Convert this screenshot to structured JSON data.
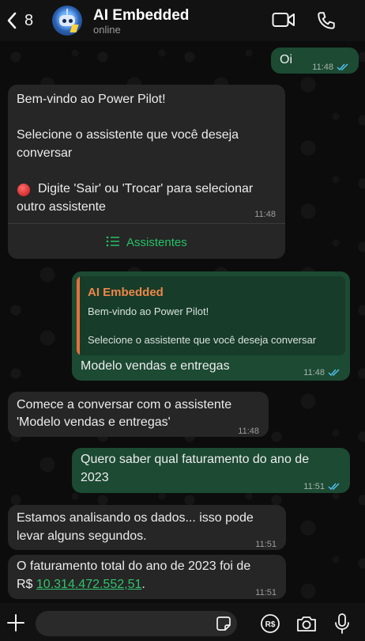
{
  "header": {
    "back_count": "8",
    "title": "AI Embedded",
    "status": "online"
  },
  "colors": {
    "accent": "#25c165",
    "outgoing": "#1c4a33",
    "incoming": "#262626",
    "quote_bar": "#e7713a"
  },
  "messages": [
    {
      "dir": "out",
      "text": "Oi",
      "time": "11:48"
    },
    {
      "dir": "in",
      "line1": "Bem-vindo ao Power Pilot!",
      "line2": "Selecione o assistente que você deseja",
      "line3": "conversar",
      "warn_icon": "red-circle-icon",
      "line4": "Digite 'Sair' ou 'Trocar' para selecionar",
      "line5": "outro assistente",
      "time": "11:48",
      "button_label": "Assistentes"
    },
    {
      "dir": "out",
      "quote_author": "AI Embedded",
      "quote_line1": "Bem-vindo ao Power Pilot!",
      "quote_line2": "Selecione o assistente que você deseja conversar",
      "text": "Modelo vendas e entregas",
      "time": "11:48"
    },
    {
      "dir": "in",
      "line1": "Comece a conversar com o assistente",
      "line2": "'Modelo vendas e entregas'",
      "time": "11:48"
    },
    {
      "dir": "out",
      "line1": "Quero saber qual faturamento do ano de",
      "line2": "2023",
      "time": "11:51"
    },
    {
      "dir": "in",
      "line1": "Estamos analisando os dados... isso pode",
      "line2": "levar alguns segundos.",
      "time": "11:51"
    },
    {
      "dir": "in",
      "line1": "O faturamento total do ano de 2023 foi de",
      "prefix": "R$",
      "amount": "10.314.472.552,51",
      "suffix": ".",
      "time": "11:51"
    }
  ],
  "composer": {
    "placeholder": ""
  }
}
